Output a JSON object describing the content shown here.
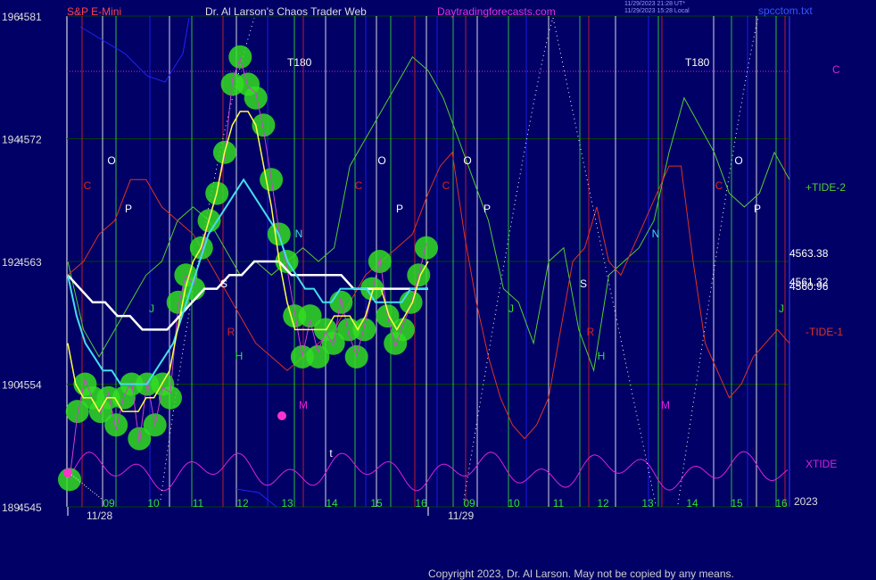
{
  "header": {
    "symbol": "S&P E-Mini",
    "title": "Dr. Al Larson's Chaos Trader Web",
    "site": "Daytradingforecasts.com",
    "stamp_line1": "11/29/2023 21:28 UT*",
    "stamp_line2": "11/29/2023 15:28 Local",
    "file": "spcctom.txt"
  },
  "copyright": "Copyright 2023, Dr. Al Larson. May not be copied by any means.",
  "year": "2023",
  "colors": {
    "background": "#000066",
    "price_dots": "#33dd22",
    "fast_avg": "#ffff44",
    "cyan_avg": "#44ddee",
    "white_avg": "#ffffff",
    "tide_plus": "#55cc33",
    "tide_minus": "#dd3322",
    "xtide": "#dd22dd",
    "blue_line": "#2222ff"
  },
  "chart_data": {
    "type": "line",
    "title": "S&P E-Mini",
    "y_labels_left": [
      {
        "a": "196",
        "b": "4581",
        "price": 4581
      },
      {
        "a": "194",
        "b": "4572",
        "price": 4572
      },
      {
        "a": "192",
        "b": "4563",
        "price": 4563
      },
      {
        "a": "190",
        "b": "4554",
        "price": 4554
      },
      {
        "a": "189",
        "b": "4545",
        "price": 4545
      }
    ],
    "ylim": [
      4545,
      4581
    ],
    "hour_ticks": [
      "09",
      "10",
      "11",
      "12",
      "13",
      "14",
      "15",
      "16",
      "09",
      "10",
      "11",
      "12",
      "13",
      "14",
      "15",
      "16"
    ],
    "dates": [
      "11/28",
      "11/29"
    ],
    "right_values": [
      "4563.38",
      "4561.32",
      "4560.96"
    ],
    "series_labels": [
      "C",
      "+TIDE-2",
      "-TIDE-1",
      "XTIDE"
    ],
    "cycle_markers": [
      {
        "label": "O",
        "color": "#ffffff"
      },
      {
        "label": "C",
        "color": "#dd2222"
      },
      {
        "label": "P",
        "color": "#ffffff"
      },
      {
        "label": "S",
        "color": "#ffffff"
      },
      {
        "label": "N",
        "color": "#44ddee"
      },
      {
        "label": "R",
        "color": "#dd2222"
      },
      {
        "label": "H",
        "color": "#33dd33"
      },
      {
        "label": "M",
        "color": "#dd22dd"
      },
      {
        "label": "J",
        "color": "#33dd33"
      },
      {
        "label": "t",
        "color": "#ffffff"
      },
      {
        "label": "O",
        "color": "#ffffff"
      },
      {
        "label": "C",
        "color": "#dd2222"
      },
      {
        "label": "P",
        "color": "#ffffff"
      },
      {
        "label": "O",
        "color": "#ffffff"
      },
      {
        "label": "C",
        "color": "#dd2222"
      },
      {
        "label": "P",
        "color": "#ffffff"
      },
      {
        "label": "N",
        "color": "#44ddee"
      },
      {
        "label": "S",
        "color": "#ffffff"
      },
      {
        "label": "R",
        "color": "#dd2222"
      },
      {
        "label": "H",
        "color": "#33dd33"
      },
      {
        "label": "M",
        "color": "#dd22dd"
      },
      {
        "label": "J",
        "color": "#33dd33"
      },
      {
        "label": "O",
        "color": "#ffffff"
      },
      {
        "label": "C",
        "color": "#dd2222"
      },
      {
        "label": "P",
        "color": "#ffffff"
      },
      {
        "label": "J",
        "color": "#33dd33"
      }
    ],
    "t180_labels": [
      "T180",
      "T180"
    ],
    "price_path": [
      4547,
      4552,
      4554,
      4553,
      4552,
      4553,
      4551,
      4553,
      4554,
      4550,
      4554,
      4551,
      4554,
      4553,
      4560,
      4562,
      4561,
      4564,
      4566,
      4568,
      4571,
      4576,
      4578,
      4576,
      4575,
      4573,
      4569,
      4565,
      4563,
      4559,
      4556,
      4559,
      4556,
      4558,
      4557,
      4560,
      4558,
      4556,
      4558,
      4561,
      4563,
      4559,
      4557,
      4558,
      4560,
      4562,
      4564
    ],
    "fast_avg": [
      4557,
      4554,
      4553,
      4553,
      4552,
      4553,
      4553,
      4552,
      4552,
      4552,
      4553,
      4553,
      4554,
      4555,
      4558,
      4561,
      4563,
      4564,
      4566,
      4568,
      4571,
      4573,
      4574,
      4574,
      4573,
      4570,
      4567,
      4563,
      4560,
      4558,
      4558,
      4558,
      4558,
      4558,
      4559,
      4559,
      4559,
      4558,
      4559,
      4561,
      4561,
      4559,
      4558,
      4559,
      4560,
      4562,
      4563
    ],
    "cyan_avg": [
      4562,
      4559,
      4557,
      4556,
      4555,
      4555,
      4554,
      4554,
      4554,
      4554,
      4555,
      4556,
      4557,
      4559,
      4561,
      4563,
      4565,
      4566,
      4567,
      4568,
      4569,
      4568,
      4567,
      4566,
      4565,
      4563,
      4562,
      4561,
      4561,
      4560,
      4560,
      4561,
      4561,
      4561,
      4561,
      4560,
      4560,
      4560,
      4560,
      4561,
      4561,
      4561
    ],
    "white_avg": [
      4562,
      4561,
      4560,
      4560,
      4559,
      4559,
      4558,
      4558,
      4558,
      4559,
      4560,
      4561,
      4561,
      4562,
      4562,
      4563,
      4563,
      4563,
      4562,
      4562,
      4562,
      4562,
      4562,
      4561,
      4561,
      4561,
      4561,
      4561,
      4561,
      4561
    ],
    "tide_plus_path": [
      4563,
      4558,
      4556,
      4558,
      4560,
      4562,
      4563,
      4566,
      4567,
      4566,
      4564,
      4562,
      4563,
      4562,
      4563,
      4564,
      4563,
      4564,
      4570,
      4572,
      4574,
      4576,
      4578,
      4577,
      4575,
      4572,
      4569,
      4566,
      4561,
      4560,
      4557,
      4563,
      4564,
      4558,
      4555,
      4562,
      4563,
      4564,
      4566,
      4571,
      4575,
      4573,
      4571,
      4568,
      4567,
      4568,
      4571,
      4569
    ],
    "tide_minus_path": [
      4562,
      4563,
      4565,
      4566,
      4569,
      4569,
      4567,
      4566,
      4565,
      4563,
      4561,
      4559,
      4557,
      4556,
      4555,
      4556,
      4557,
      4558,
      4560,
      4562,
      4563,
      4564,
      4565,
      4568,
      4570,
      4571,
      4565,
      4560,
      4556,
      4553,
      4551,
      4550,
      4551,
      4553,
      4558,
      4563,
      4564,
      4567,
      4563,
      4562,
      4564,
      4566,
      4568,
      4570,
      4570,
      4563,
      4557,
      4555,
      4553,
      4554,
      4556,
      4557,
      4558,
      4557
    ],
    "xtide_amplitude": 2.5
  }
}
